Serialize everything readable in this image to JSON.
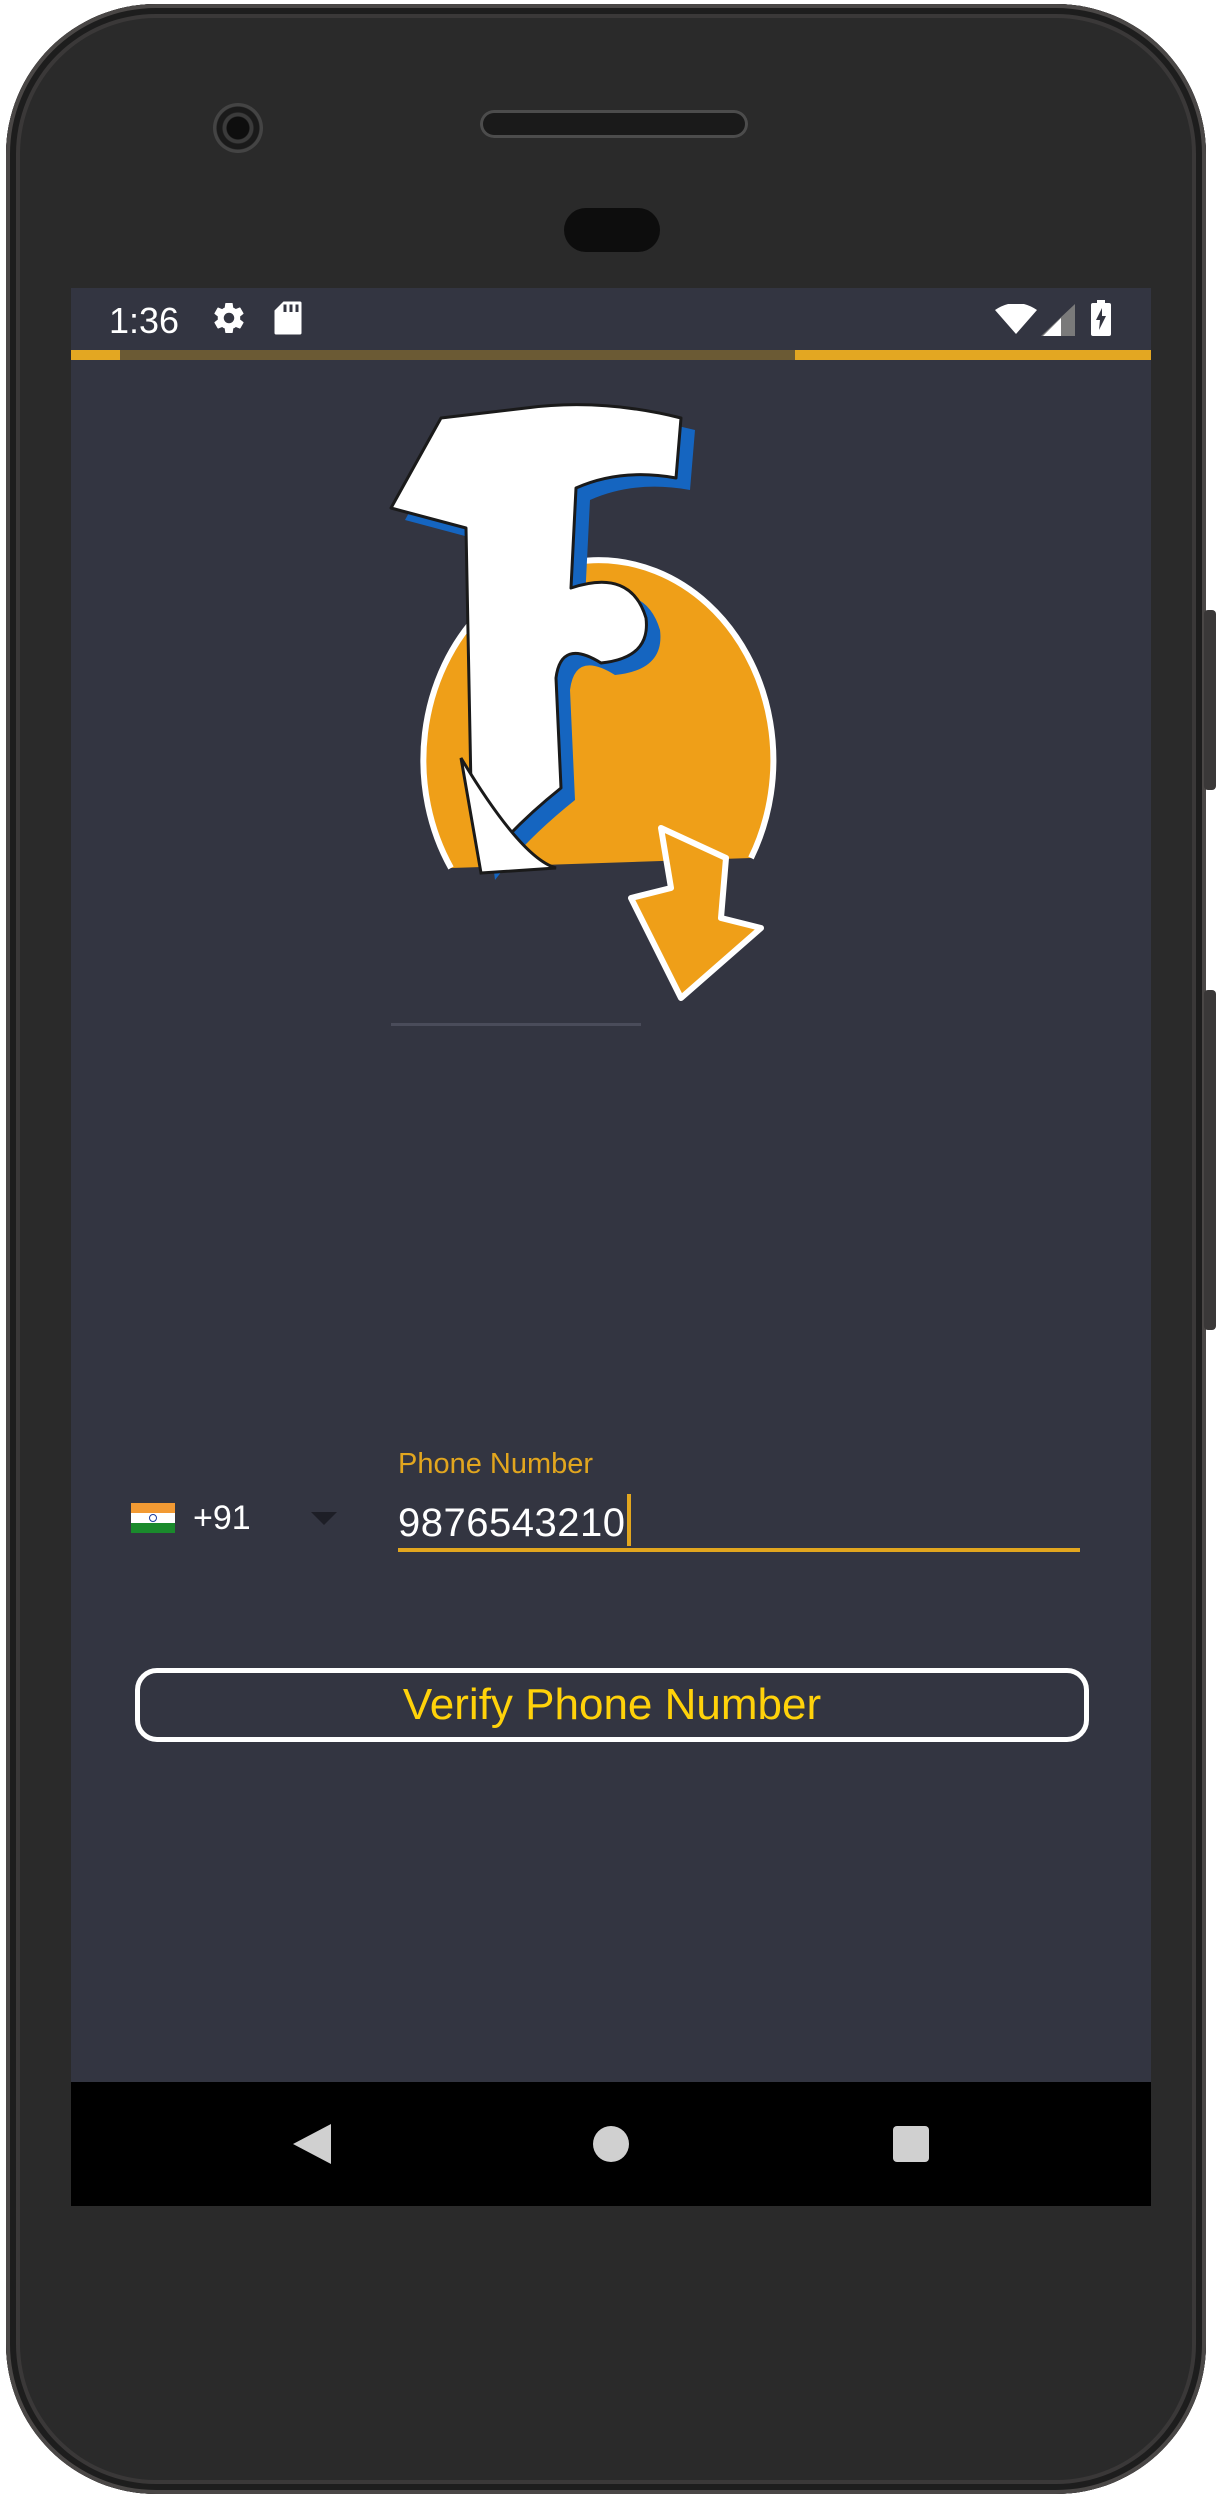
{
  "status_bar": {
    "time": "1:36",
    "icons": [
      "gear-icon",
      "sd-card-icon",
      "wifi-icon",
      "signal-icon",
      "battery-charging-icon"
    ]
  },
  "loading_progress": {
    "segments": [
      [
        0.0,
        0.045
      ],
      [
        0.67,
        1.0
      ]
    ],
    "color": "#e3a722"
  },
  "logo": {
    "icon": "app-logo-F-arrow",
    "colors": {
      "circle": "#ef9f18",
      "letter": "#ffffff",
      "shadow": "#1565c0"
    }
  },
  "phone_form": {
    "country_flag": "india-flag-icon",
    "dial_code": "+91",
    "label": "Phone Number",
    "value": "9876543210"
  },
  "verify_button": {
    "label": "Verify Phone Number"
  },
  "nav_bar": {
    "icons": [
      "back-icon",
      "home-icon",
      "recents-icon"
    ]
  },
  "theme": {
    "background": "#333541",
    "accent": "#e2a61e",
    "button_text": "#ffd20a"
  }
}
